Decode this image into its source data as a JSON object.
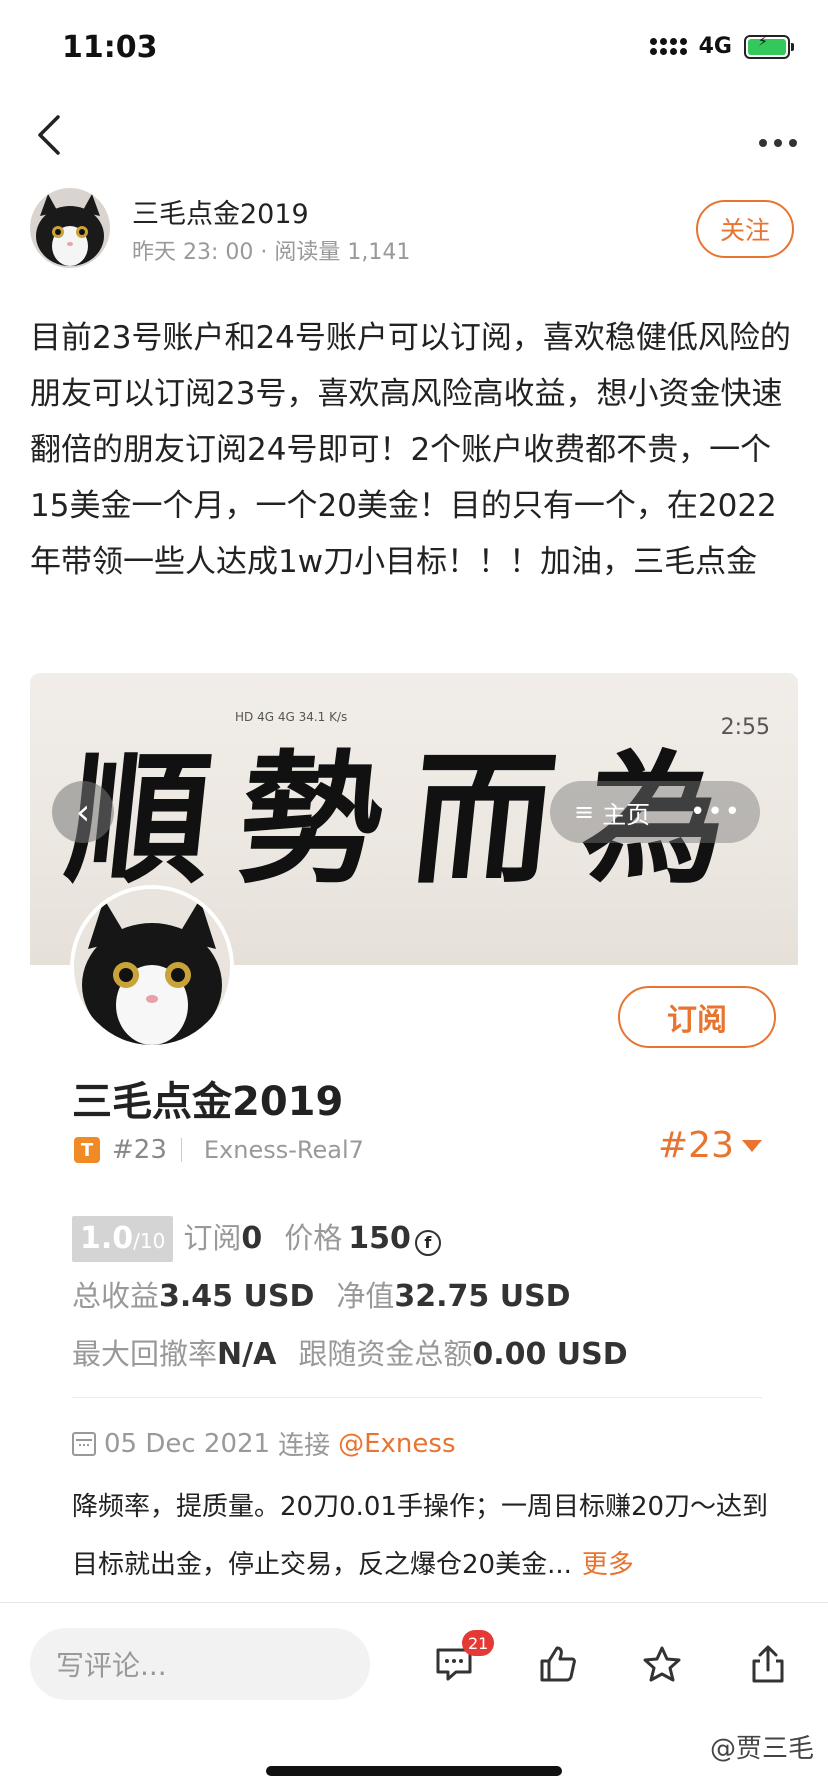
{
  "status_bar": {
    "time": "11:03",
    "network": "4G"
  },
  "author": {
    "name": "三毛点金2019",
    "meta": "昨天 23: 00 · 阅读量 1,141",
    "follow_label": "关注"
  },
  "post": {
    "text": "目前23号账户和24号账户可以订阅，喜欢稳健低风险的朋友可以订阅23号，喜欢高风险高收益，想小资金快速翻倍的朋友订阅24号即可！2个账户收费都不贵，一个15美金一个月，一个20美金！目的只有一个，在2022年带领一些人达成1w刀小目标！！！加油，三毛点金"
  },
  "card": {
    "banner_status_left": "HD 4G 4G 34.1 K/s",
    "banner_status_time": "2:55",
    "banner_calligraphy": "順勢而為",
    "banner_home_label": "主页",
    "subscribe_label": "订阅",
    "name": "三毛点金2019",
    "tag_badge": "T",
    "tag_id": "#23",
    "server": "Exness-Real7",
    "account_selected": "#23",
    "rating": "1.0",
    "rating_max": "/10",
    "subscribe_count_label": "订阅",
    "subscribe_count": "0",
    "price_label": "价格",
    "price_value": "150",
    "coin_symbol": "f",
    "total_profit_label": "总收益",
    "total_profit_value": "3.45 USD",
    "net_value_label": "净值",
    "net_value_value": "32.75 USD",
    "max_drawdown_label": "最大回撤率",
    "max_drawdown_value": "N/A",
    "follow_funds_label": "跟随资金总额",
    "follow_funds_value": "0.00 USD",
    "date": "05 Dec 2021",
    "connect_label": "连接",
    "broker_link": "@Exness",
    "description": "降频率，提质量。20刀0.01手操作；一周目标赚20刀～达到目标就出金，停止交易，反之爆仓20美金...",
    "more_label": "更多"
  },
  "bottom_bar": {
    "comment_placeholder": "写评论...",
    "comment_count": "21",
    "watermark": "@贾三毛"
  }
}
